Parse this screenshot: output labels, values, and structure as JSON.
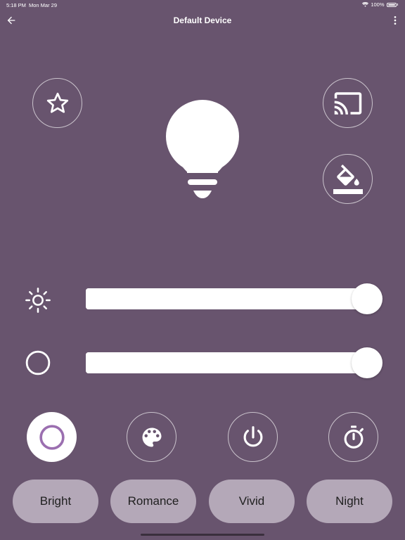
{
  "status_bar": {
    "time": "5:18 PM",
    "date": "Mon Mar 29",
    "battery": "100%"
  },
  "header": {
    "title": "Default Device",
    "back_icon": "arrow-left-icon",
    "more_icon": "more-vertical-icon"
  },
  "actions": {
    "favorite_icon": "star-outline-icon",
    "cast_icon": "cast-icon",
    "paint_icon": "format-color-fill-icon"
  },
  "light": {
    "icon": "lightbulb-icon"
  },
  "sliders": {
    "brightness": {
      "icon": "brightness-icon",
      "value_percent": 100
    },
    "color_temp": {
      "icon": "circle-outline-icon",
      "value_percent": 100
    }
  },
  "modes": {
    "color_mode_icon": "circle-ring-icon",
    "palette_icon": "palette-icon",
    "power_icon": "power-icon",
    "timer_icon": "timer-icon"
  },
  "presets": [
    {
      "label": "Bright"
    },
    {
      "label": "Romance"
    },
    {
      "label": "Vivid"
    },
    {
      "label": "Night"
    }
  ],
  "colors": {
    "background": "#68546e",
    "preset_bg": "#b4a8b8",
    "accent": "#9b6fb0"
  }
}
